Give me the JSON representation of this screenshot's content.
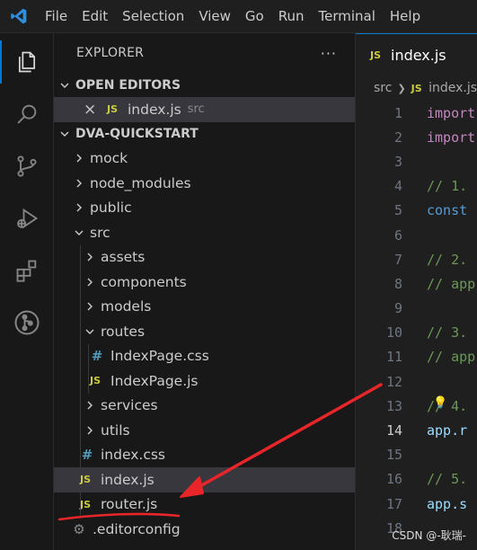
{
  "menubar": {
    "items": [
      "File",
      "Edit",
      "Selection",
      "View",
      "Go",
      "Run",
      "Terminal",
      "Help"
    ]
  },
  "activity_bar": {
    "icons": [
      "explorer-icon",
      "search-icon",
      "source-control-icon",
      "run-debug-icon",
      "extensions-icon",
      "git-graph-icon"
    ]
  },
  "explorer": {
    "title": "EXPLORER",
    "more": "···",
    "open_editors": {
      "header": "OPEN EDITORS",
      "item": {
        "close": "×",
        "badge": "JS",
        "name": "index.js",
        "folder": "src"
      }
    },
    "project": {
      "header": "DVA-QUICKSTART",
      "items": [
        {
          "label": "mock"
        },
        {
          "label": "node_modules"
        },
        {
          "label": "public"
        },
        {
          "label": "src"
        },
        {
          "label": "assets"
        },
        {
          "label": "components"
        },
        {
          "label": "models"
        },
        {
          "label": "routes"
        },
        {
          "label": "IndexPage.css",
          "badge": "#"
        },
        {
          "label": "IndexPage.js",
          "badge": "JS"
        },
        {
          "label": "services"
        },
        {
          "label": "utils"
        },
        {
          "label": "index.css",
          "badge": "#"
        },
        {
          "label": "index.js",
          "badge": "JS"
        },
        {
          "label": "router.js",
          "badge": "JS"
        },
        {
          "label": ".editorconfig"
        }
      ]
    }
  },
  "editor": {
    "tab": {
      "badge": "JS",
      "label": "index.js"
    },
    "breadcrumb": {
      "folder": "src",
      "badge": "JS",
      "file": "index.js"
    },
    "current_line": 14,
    "lines": [
      {
        "n": "1",
        "text": "import"
      },
      {
        "n": "2",
        "text": "import"
      },
      {
        "n": "3",
        "text": ""
      },
      {
        "n": "4",
        "text": "// 1."
      },
      {
        "n": "5",
        "text": "const"
      },
      {
        "n": "6",
        "text": ""
      },
      {
        "n": "7",
        "text": "// 2."
      },
      {
        "n": "8",
        "text": "// app"
      },
      {
        "n": "9",
        "text": ""
      },
      {
        "n": "10",
        "text": "// 3."
      },
      {
        "n": "11",
        "text": "// app"
      },
      {
        "n": "12",
        "text": ""
      },
      {
        "n": "13",
        "text": "// 4."
      },
      {
        "n": "14",
        "text": "app.r"
      },
      {
        "n": "15",
        "text": ""
      },
      {
        "n": "16",
        "text": "// 5."
      },
      {
        "n": "17",
        "text": "app.s"
      },
      {
        "n": "18",
        "text": ""
      }
    ]
  },
  "colors": {
    "accent": "#0078d4",
    "annotation": "#e8262a",
    "js": "#cbcb41",
    "css": "#519aba"
  },
  "watermark": "CSDN @-耿瑞-"
}
